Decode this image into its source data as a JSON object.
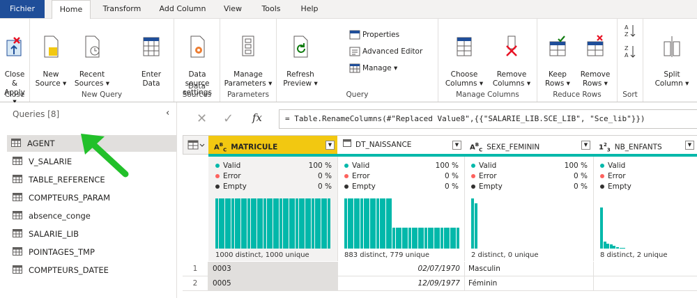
{
  "tabs": [
    "Fichier",
    "Home",
    "Transform",
    "Add Column",
    "View",
    "Tools",
    "Help"
  ],
  "ribbon": {
    "close_apply": "Close &\nApply ▾",
    "new_source": "New\nSource ▾",
    "recent_sources": "Recent\nSources ▾",
    "enter_data": "Enter\nData",
    "data_source_settings": "Data source\nsettings",
    "manage_parameters": "Manage\nParameters ▾",
    "refresh_preview": "Refresh\nPreview ▾",
    "properties": "Properties",
    "advanced_editor": "Advanced Editor",
    "manage": "Manage ▾",
    "choose_columns": "Choose\nColumns ▾",
    "remove_columns": "Remove\nColumns ▾",
    "keep_rows": "Keep\nRows ▾",
    "remove_rows": "Remove\nRows ▾",
    "split_column": "Split\nColumn ▾",
    "groups": {
      "close": "Close",
      "new_query": "New Query",
      "data_sources": "Data Sources",
      "parameters": "Parameters",
      "query": "Query",
      "manage_columns": "Manage Columns",
      "reduce_rows": "Reduce Rows",
      "sort": "Sort"
    }
  },
  "queries": {
    "header": "Queries [8]",
    "items": [
      "AGENT",
      "V_SALARIE",
      "TABLE_REFERENCE",
      "COMPTEURS_PARAM",
      "absence_conge",
      "SALARIE_LIB",
      "POINTAGES_TMP",
      "COMPTEURS_DATEE"
    ],
    "selected": "AGENT"
  },
  "formula": {
    "fx": "fx",
    "text": "= Table.RenameColumns(#\"Replaced Value8\",{{\"SALARIE_LIB.SCE_LIB\", \"Sce_lib\"}})"
  },
  "columns": [
    {
      "type_icon": "ABC",
      "name": "MATRICULE",
      "valid": "100 %",
      "error": "0 %",
      "empty": "0 %",
      "footer": "1000 distinct, 1000 unique"
    },
    {
      "type_icon": "calendar",
      "name": "DT_NAISSANCE",
      "valid": "100 %",
      "error": "0 %",
      "empty": "0 %",
      "footer": "883 distinct, 779 unique"
    },
    {
      "type_icon": "ABC",
      "name": "SEXE_FEMININ",
      "valid": "100 %",
      "error": "0 %",
      "empty": "0 %",
      "footer": "2 distinct, 0 unique"
    },
    {
      "type_icon": "123",
      "name": "NB_ENFANTS",
      "valid": "",
      "error": "",
      "empty": "",
      "footer": "8 distinct, 2 unique"
    }
  ],
  "quality_labels": {
    "valid": "Valid",
    "error": "Error",
    "empty": "Empty"
  },
  "colors": {
    "valid": "#01b8aa",
    "error": "#fd625e",
    "empty": "#323130",
    "selected_header": "#f2c811",
    "file_tab": "#1f4e99",
    "annotation_arrow": "#22c02a"
  },
  "rows": [
    {
      "n": "1",
      "matricule": "0003",
      "dt_naissance": "02/07/1970",
      "sexe": "Masculin",
      "nb": ""
    },
    {
      "n": "2",
      "matricule": "0005",
      "dt_naissance": "12/09/1977",
      "sexe": "Féminin",
      "nb": ""
    }
  ]
}
